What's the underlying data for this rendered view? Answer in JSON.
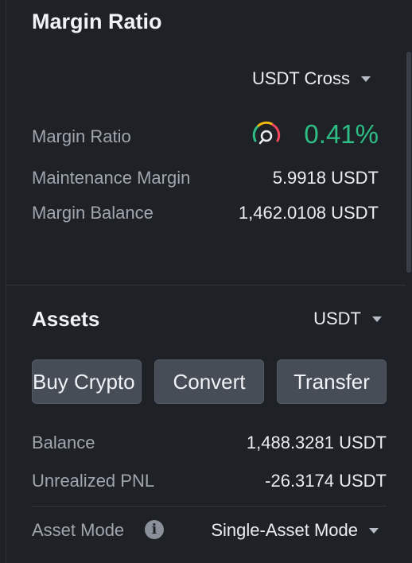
{
  "margin_ratio_section": {
    "title": "Margin Ratio",
    "mode_selector": "USDT Cross",
    "rows": {
      "margin_ratio_label": "Margin Ratio",
      "margin_ratio_value": "0.41%",
      "maintenance_label": "Maintenance Margin",
      "maintenance_value": "5.9918 USDT",
      "balance_label": "Margin Balance",
      "balance_value": "1,462.0108 USDT"
    },
    "gauge_icon": "speedometer-gauge-icon",
    "ratio_color": "#2ebd85"
  },
  "assets_section": {
    "title": "Assets",
    "currency_selector": "USDT",
    "buttons": {
      "buy": "Buy Crypto",
      "convert": "Convert",
      "transfer": "Transfer"
    },
    "rows": {
      "balance_label": "Balance",
      "balance_value": "1,488.3281 USDT",
      "pnl_label": "Unrealized PNL",
      "pnl_value": "-26.3174 USDT",
      "asset_mode_label": "Asset Mode",
      "asset_mode_value": "Single-Asset Mode"
    },
    "info_icon": "info-icon"
  }
}
